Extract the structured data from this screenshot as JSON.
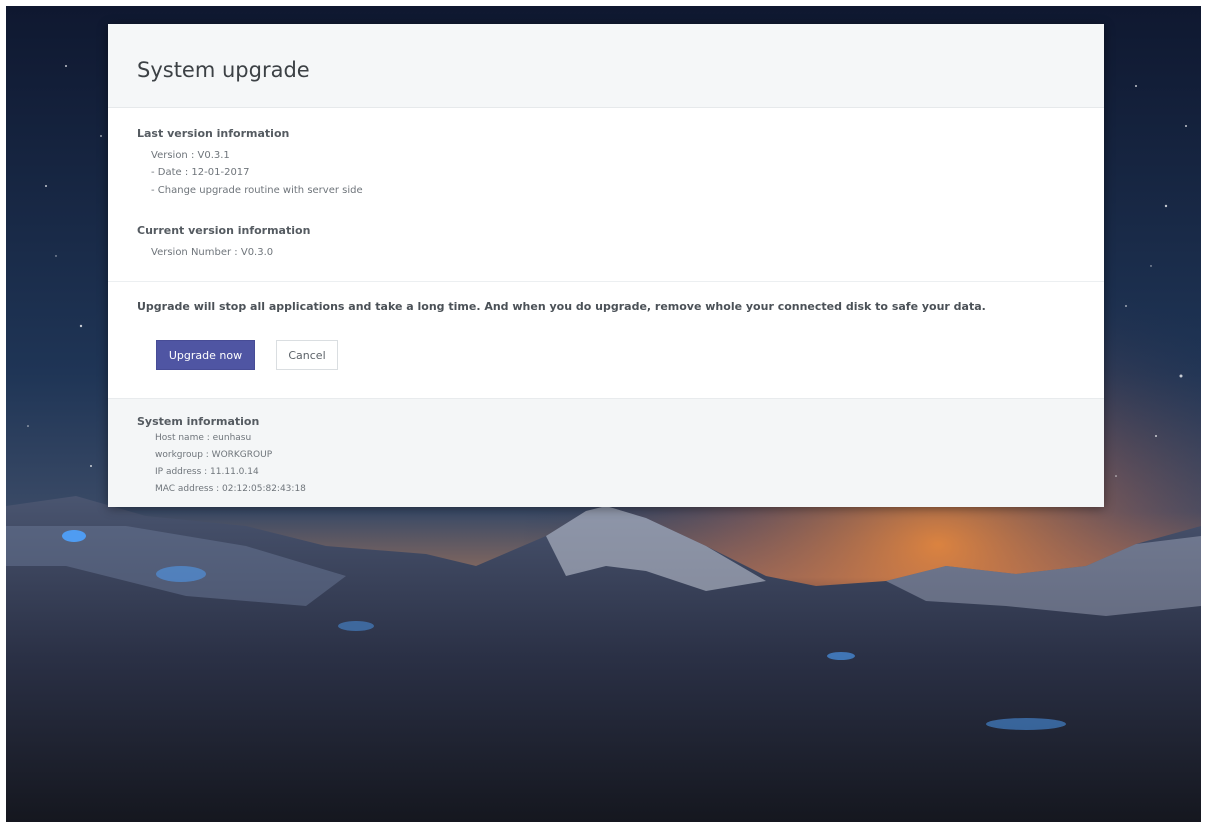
{
  "dialog": {
    "title": "System upgrade"
  },
  "last_version": {
    "heading": "Last version information",
    "lines": [
      "Version : V0.3.1",
      "- Date : 12-01-2017",
      "- Change upgrade routine with server side"
    ]
  },
  "current_version": {
    "heading": "Current version information",
    "line": "Version Number : V0.3.0"
  },
  "warning": "Upgrade will stop all applications and take a long time. And when you do upgrade, remove whole your connected disk to safe your data.",
  "buttons": {
    "upgrade_label": "Upgrade now",
    "cancel_label": "Cancel"
  },
  "system_info": {
    "heading": "System information",
    "lines": [
      "Host name : eunhasu",
      "workgroup : WORKGROUP",
      "IP address : 11.11.0.14",
      "MAC address : 02:12:05:82:43:18"
    ]
  },
  "colors": {
    "primary_button": "#4f55a3",
    "header_bg": "#f5f7f8",
    "footer_bg": "#f4f6f7"
  }
}
